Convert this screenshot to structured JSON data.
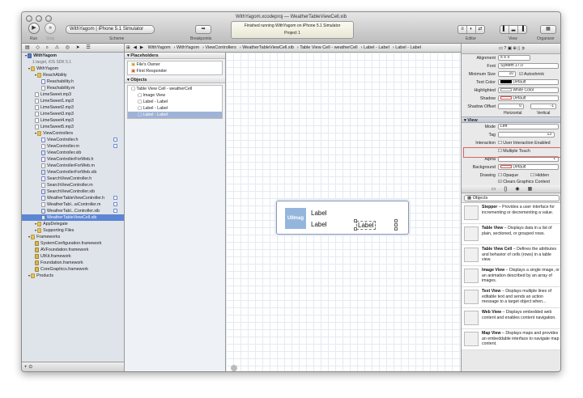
{
  "window": {
    "title": "WeatherTableViewCell.xib",
    "project": "WithYagom.xcodeproj"
  },
  "toolbar": {
    "run": "Run",
    "stop": "Stop",
    "scheme_label": "Scheme",
    "scheme_value": "WithYagom  |  iPhone 5.1 Simulator",
    "breakpoints": "Breakpoints",
    "activity": "Finished running WithYagom on iPhone 5.1 Simulator",
    "activity_sub": "Project",
    "activity_count": "1",
    "editor": "Editor",
    "view": "View",
    "organizer": "Organizer"
  },
  "jumpbar": [
    "WithYagom",
    "WithYagom",
    "ViewControllers",
    "WeatherTableViewCell.xib",
    "Table View Cell - weatherCell",
    "Label - Label",
    "Label - Label"
  ],
  "navigator": {
    "items": [
      {
        "label": "WithYagom",
        "type": "proj",
        "indent": 4,
        "bold": true
      },
      {
        "label": "1 target, iOS SDK 5.1",
        "type": "none",
        "indent": 13
      },
      {
        "label": "WithYagom",
        "type": "folder",
        "indent": 8
      },
      {
        "label": "ReachAbility",
        "type": "folder",
        "indent": 16
      },
      {
        "label": "Reachability.h",
        "type": "hfile",
        "indent": 24
      },
      {
        "label": "Reachability.m",
        "type": "file",
        "indent": 24
      },
      {
        "label": "LimeSweet.mp3",
        "type": "file",
        "indent": 16
      },
      {
        "label": "LimeSweet1.mp3",
        "type": "file",
        "indent": 16
      },
      {
        "label": "LimeSweet2.mp3",
        "type": "file",
        "indent": 16
      },
      {
        "label": "LimeSweet3.mp3",
        "type": "file",
        "indent": 16
      },
      {
        "label": "LimeSweet4.mp3",
        "type": "file",
        "indent": 16
      },
      {
        "label": "LimeSweet5.mp3",
        "type": "file",
        "indent": 16
      },
      {
        "label": "ViewControllers",
        "type": "folder",
        "indent": 16
      },
      {
        "label": "ViewController.h",
        "type": "hfile",
        "indent": 24,
        "badge": true
      },
      {
        "label": "ViewController.m",
        "type": "file",
        "indent": 24,
        "badge": true
      },
      {
        "label": "ViewController.xib",
        "type": "xib",
        "indent": 24
      },
      {
        "label": "ViewControllerForWeb.h",
        "type": "hfile",
        "indent": 24
      },
      {
        "label": "ViewControllerForWeb.m",
        "type": "file",
        "indent": 24
      },
      {
        "label": "ViewControllerForWeb.xib",
        "type": "xib",
        "indent": 24
      },
      {
        "label": "SearchViewController.h",
        "type": "hfile",
        "indent": 24
      },
      {
        "label": "SearchViewController.m",
        "type": "file",
        "indent": 24
      },
      {
        "label": "SearchViewController.xib",
        "type": "xib",
        "indent": 24
      },
      {
        "label": "WeatherTableViewController.h",
        "type": "hfile",
        "indent": 24,
        "badge": true
      },
      {
        "label": "WeatherTabl...wController.m",
        "type": "file",
        "indent": 24,
        "badge": true
      },
      {
        "label": "WeatherTabl...Controller.xib",
        "type": "xib",
        "indent": 24,
        "badge": true
      },
      {
        "label": "WeatherTableViewCell.xib",
        "type": "xib",
        "indent": 24,
        "selected": true
      },
      {
        "label": "AppDelegate",
        "type": "folder",
        "indent": 16
      },
      {
        "label": "Supporting Files",
        "type": "folder",
        "indent": 16
      },
      {
        "label": "Frameworks",
        "type": "folder",
        "indent": 8
      },
      {
        "label": "SystemConfiguration.framework",
        "type": "fw",
        "indent": 16
      },
      {
        "label": "AVFoundation.framework",
        "type": "fw",
        "indent": 16
      },
      {
        "label": "UIKit.framework",
        "type": "fw",
        "indent": 16
      },
      {
        "label": "Foundation.framework",
        "type": "fw",
        "indent": 16
      },
      {
        "label": "CoreGraphics.framework",
        "type": "fw",
        "indent": 16
      },
      {
        "label": "Products",
        "type": "folder",
        "indent": 8
      }
    ]
  },
  "outline": {
    "placeholders_title": "Placeholders",
    "placeholders": [
      "File's Owner",
      "First Responder"
    ],
    "objects_title": "Objects",
    "objects": [
      {
        "label": "Table View Cell - weatherCell",
        "indent": 4
      },
      {
        "label": "Image View",
        "indent": 12
      },
      {
        "label": "Label - Label",
        "indent": 12
      },
      {
        "label": "Label - Label",
        "indent": 12
      },
      {
        "label": "Label - Label",
        "indent": 12,
        "selected": true
      }
    ]
  },
  "canvas": {
    "image_label": "UIImag",
    "label1": "Label",
    "label2": "Label",
    "label3": "Label"
  },
  "inspector": {
    "top_label": "Alignment",
    "font_label": "Font",
    "font_value": "System 17.0",
    "minsize_label": "Minimum Size",
    "minsize_value": "10",
    "autoshrink": "Autoshrink",
    "textcolor_label": "Text Color",
    "textcolor_value": "Default",
    "highlighted_label": "Highlighted",
    "highlighted_value": "White Color",
    "shadow_label": "Shadow",
    "shadow_value": "Default",
    "shadowoffset_label": "Shadow Offset",
    "shadowoffset_h": "0",
    "shadowoffset_v": "-1",
    "horizontal": "Horizontal",
    "vertical": "Vertical",
    "view_header": "View",
    "mode_label": "Mode",
    "mode_value": "Left",
    "tag_label": "Tag",
    "tag_value": "13",
    "interaction_label": "Interaction",
    "uie": "User Interaction Enabled",
    "mt": "Multiple Touch",
    "alpha_label": "Alpha",
    "alpha_value": "1",
    "bg_label": "Background",
    "bg_value": "Default",
    "drawing_label": "Drawing",
    "opaque": "Opaque",
    "hidden": "Hidden",
    "clears": "Clears Graphics Context"
  },
  "library": {
    "selector": "Objects",
    "items": [
      {
        "name": "Stepper",
        "desc": "Provides a user interface for incrementing or decrementing a value."
      },
      {
        "name": "Table View",
        "desc": "Displays data in a list of plain, sectioned, or grouped rows."
      },
      {
        "name": "Table View Cell",
        "desc": "Defines the attributes and behavior of cells (rows) in a table view."
      },
      {
        "name": "Image View",
        "desc": "Displays a single image, or an animation described by an array of images."
      },
      {
        "name": "Text View",
        "desc": "Displays multiple lines of editable text and sends an action message to a target object when..."
      },
      {
        "name": "Web View",
        "desc": "Displays embedded web content and enables content navigation."
      },
      {
        "name": "Map View",
        "desc": "Displays maps and provides an embeddable interface to navigate map content."
      }
    ]
  }
}
